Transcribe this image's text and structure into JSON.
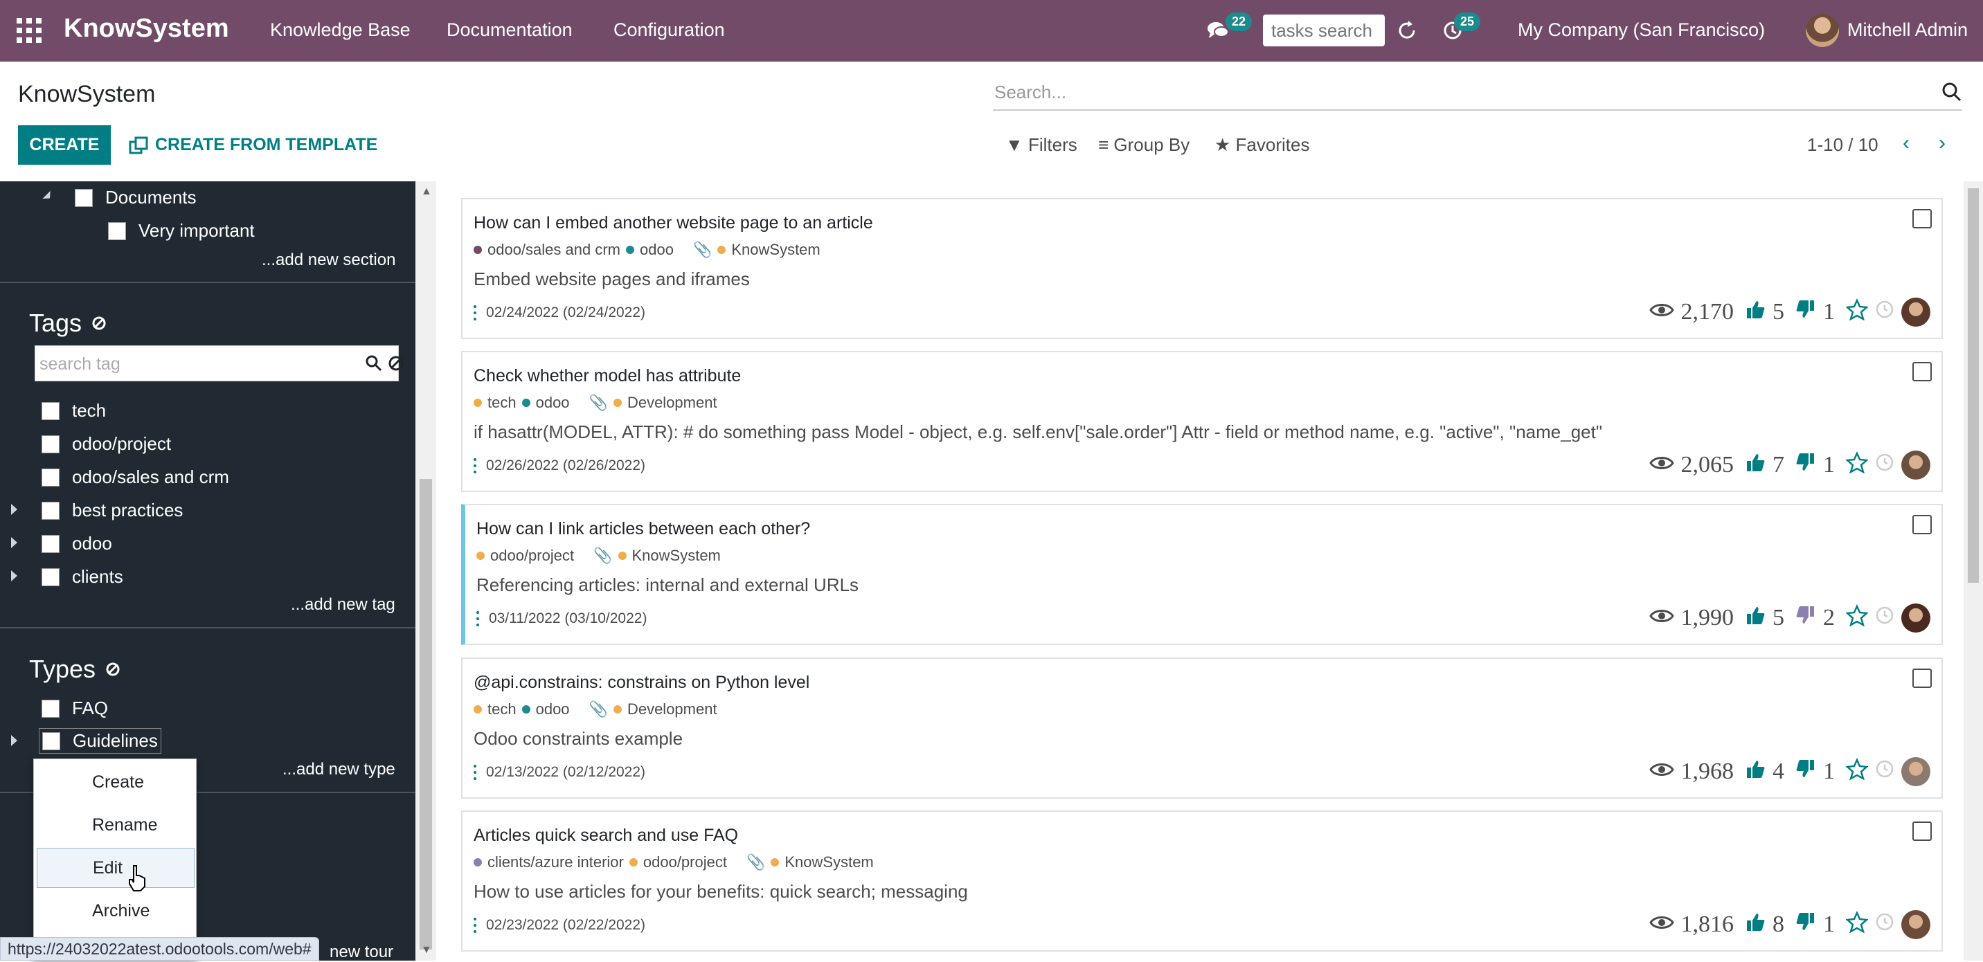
{
  "navbar": {
    "brand": "KnowSystem",
    "menu": [
      "Knowledge Base",
      "Documentation",
      "Configuration"
    ],
    "messages_badge": "22",
    "tasks_search_placeholder": "tasks search",
    "activity_badge": "25",
    "company": "My Company (San Francisco)",
    "user": "Mitchell Admin"
  },
  "control_panel": {
    "title": "KnowSystem",
    "create_label": "CREATE",
    "create_template_label": "CREATE FROM TEMPLATE",
    "search_placeholder": "Search...",
    "filters_label": "Filters",
    "group_by_label": "Group By",
    "favorites_label": "Favorites",
    "pager": "1-10 / 10"
  },
  "sidebar": {
    "sections": {
      "items": [
        "Documents",
        "Very important"
      ],
      "add_label": "...add new section"
    },
    "tags": {
      "heading": "Tags",
      "search_placeholder": "search tag",
      "items": [
        "tech",
        "odoo/project",
        "odoo/sales and crm",
        "best practices",
        "odoo",
        "clients"
      ],
      "add_label": "...add new tag"
    },
    "types": {
      "heading": "Types",
      "items": [
        "FAQ",
        "Guidelines"
      ],
      "add_label": "...add new type"
    },
    "partial_label": "new tour"
  },
  "context_menu": {
    "items": [
      "Create",
      "Rename",
      "Edit",
      "Archive"
    ],
    "selected": "Edit"
  },
  "status_url": "https://24032022atest.odootools.com/web#",
  "articles": [
    {
      "title": "How can I embed another website page to an article",
      "tags": [
        {
          "label": "odoo/sales and crm",
          "color": "#714b67"
        },
        {
          "label": "odoo",
          "color": "#1d8b8e"
        }
      ],
      "section": {
        "label": "KnowSystem",
        "color": "#f0ad4e"
      },
      "description": "Embed website pages and iframes",
      "date": "02/24/2022 (02/24/2022)",
      "views": "2,170",
      "likes": "5",
      "dislikes": "1"
    },
    {
      "title": "Check whether model has attribute",
      "tags": [
        {
          "label": "tech",
          "color": "#f0ad4e"
        },
        {
          "label": "odoo",
          "color": "#1d8b8e"
        }
      ],
      "section": {
        "label": "Development",
        "color": "#f0ad4e"
      },
      "description": "if hasattr(MODEL, ATTR):      # do something        pass Model - object, e.g. self.env[\"sale.order\"] Attr - field or method name, e.g. \"active\", \"name_get\"",
      "date": "02/26/2022 (02/26/2022)",
      "views": "2,065",
      "likes": "7",
      "dislikes": "1"
    },
    {
      "title": "How can I link articles between each other?",
      "tags": [
        {
          "label": "odoo/project",
          "color": "#f0ad4e"
        }
      ],
      "section": {
        "label": "KnowSystem",
        "color": "#f0ad4e"
      },
      "description": "Referencing articles: internal and external URLs",
      "date": "03/11/2022 (03/10/2022)",
      "views": "1,990",
      "likes": "5",
      "dislikes": "2"
    },
    {
      "title": "@api.constrains: constrains on Python level",
      "tags": [
        {
          "label": "tech",
          "color": "#f0ad4e"
        },
        {
          "label": "odoo",
          "color": "#1d8b8e"
        }
      ],
      "section": {
        "label": "Development",
        "color": "#f0ad4e"
      },
      "description": "Odoo constraints example",
      "date": "02/13/2022 (02/12/2022)",
      "views": "1,968",
      "likes": "4",
      "dislikes": "1"
    },
    {
      "title": "Articles quick search and use FAQ",
      "tags": [
        {
          "label": "clients/azure interior",
          "color": "#8d7fb0"
        },
        {
          "label": "odoo/project",
          "color": "#f0ad4e"
        }
      ],
      "section": {
        "label": "KnowSystem",
        "color": "#f0ad4e"
      },
      "description": "How to use articles for your benefits: quick search; messaging",
      "date": "02/23/2022 (02/22/2022)",
      "views": "1,816",
      "likes": "8",
      "dislikes": "1"
    }
  ],
  "colors": {
    "brand": "#714b67",
    "accent": "#017e84",
    "sidebar": "#212a33",
    "badge": "#1d8b8e"
  }
}
